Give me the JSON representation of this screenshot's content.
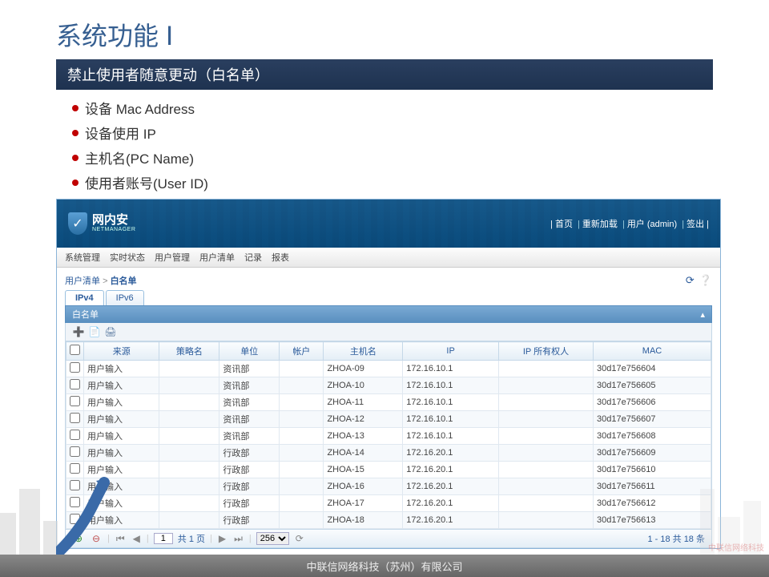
{
  "slide": {
    "title": "系统功能 Ⅰ",
    "subtitle": "禁止使用者随意更动（白名单）",
    "bullets": [
      "设备 Mac Address",
      "设备使用 IP",
      "主机名(PC Name)",
      "使用者账号(User ID)"
    ]
  },
  "app": {
    "logo_cn": "网内安",
    "logo_en": "NETMANAGER",
    "nav": {
      "home": "首页",
      "reload": "重新加载",
      "user": "用户 (admin)",
      "logout": "签出"
    },
    "menu": [
      "系统管理",
      "实时状态",
      "用户管理",
      "用户清单",
      "记录",
      "报表"
    ],
    "breadcrumb": {
      "a": "用户清单",
      "sep": ">",
      "b": "白名单"
    },
    "tabs": [
      "IPv4",
      "IPv6"
    ],
    "active_tab": 0,
    "panel_title": "白名单",
    "columns": [
      "",
      "来源",
      "策略名",
      "单位",
      "帐户",
      "主机名",
      "IP",
      "IP 所有权人",
      "MAC"
    ],
    "rows": [
      {
        "src": "用户输入",
        "policy": "",
        "unit": "资讯部",
        "acct": "",
        "host": "ZHOA-09",
        "ip": "172.16.10.1",
        "owner": "",
        "mac": "30d17e756604"
      },
      {
        "src": "用户输入",
        "policy": "",
        "unit": "资讯部",
        "acct": "",
        "host": "ZHOA-10",
        "ip": "172.16.10.1",
        "owner": "",
        "mac": "30d17e756605"
      },
      {
        "src": "用户输入",
        "policy": "",
        "unit": "资讯部",
        "acct": "",
        "host": "ZHOA-11",
        "ip": "172.16.10.1",
        "owner": "",
        "mac": "30d17e756606"
      },
      {
        "src": "用户输入",
        "policy": "",
        "unit": "资讯部",
        "acct": "",
        "host": "ZHOA-12",
        "ip": "172.16.10.1",
        "owner": "",
        "mac": "30d17e756607"
      },
      {
        "src": "用户输入",
        "policy": "",
        "unit": "资讯部",
        "acct": "",
        "host": "ZHOA-13",
        "ip": "172.16.10.1",
        "owner": "",
        "mac": "30d17e756608"
      },
      {
        "src": "用户输入",
        "policy": "",
        "unit": "行政部",
        "acct": "",
        "host": "ZHOA-14",
        "ip": "172.16.20.1",
        "owner": "",
        "mac": "30d17e756609"
      },
      {
        "src": "用户输入",
        "policy": "",
        "unit": "行政部",
        "acct": "",
        "host": "ZHOA-15",
        "ip": "172.16.20.1",
        "owner": "",
        "mac": "30d17e756610"
      },
      {
        "src": "用户输入",
        "policy": "",
        "unit": "行政部",
        "acct": "",
        "host": "ZHOA-16",
        "ip": "172.16.20.1",
        "owner": "",
        "mac": "30d17e756611"
      },
      {
        "src": "用户输入",
        "policy": "",
        "unit": "行政部",
        "acct": "",
        "host": "ZHOA-17",
        "ip": "172.16.20.1",
        "owner": "",
        "mac": "30d17e756612"
      },
      {
        "src": "用户输入",
        "policy": "",
        "unit": "行政部",
        "acct": "",
        "host": "ZHOA-18",
        "ip": "172.16.20.1",
        "owner": "",
        "mac": "30d17e756613"
      }
    ],
    "pager": {
      "page": "1",
      "pages_text": "共 1 页",
      "size": "256",
      "summary": "1 - 18  共 18 条"
    }
  },
  "footer": "中联信网络科技（苏州）有限公司",
  "watermark": "中联信网络科技"
}
